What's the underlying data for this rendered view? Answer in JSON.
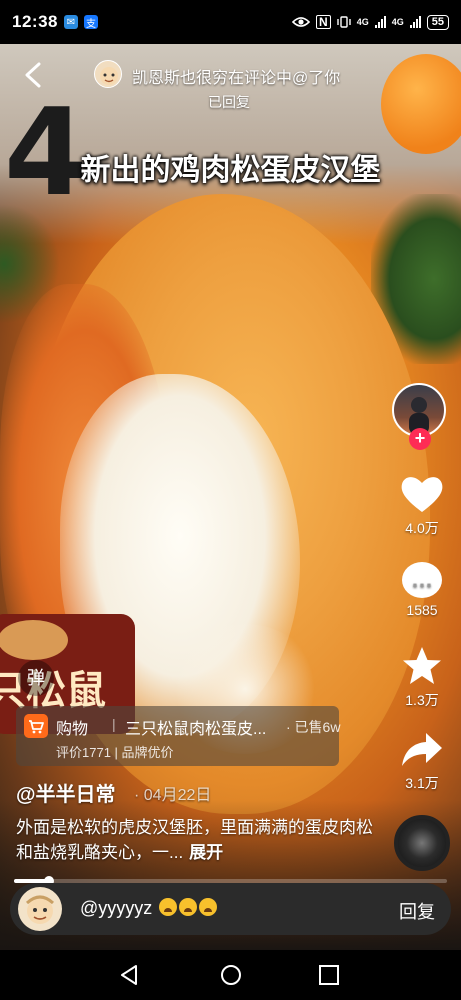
{
  "status_bar": {
    "time": "12:38",
    "battery": "55",
    "network_1": "4G",
    "network_2": "4G",
    "nfc": "N"
  },
  "overlay": {
    "notification_text": "凯恩斯也很穷在评论中@了你",
    "notification_sub": "已回复",
    "caption": "新出的鸡肉松蛋皮汉堡",
    "danmaku_label": "弹"
  },
  "background_text": {
    "big_number": "4",
    "package_text": "只松鼠"
  },
  "right_rail": {
    "likes": "4.0万",
    "comments": "1585",
    "favorites": "1.3万",
    "shares": "3.1万"
  },
  "product": {
    "category": "购物",
    "name": "三只松鼠肉松蛋皮...",
    "sold": "· 已售6w",
    "meta": "评价1771 | 品牌优价"
  },
  "post": {
    "author": "@半半日常",
    "date": "· 04月22日",
    "description": "外面是松软的虎皮汉堡胚，里面满满的蛋皮肉松和盐烧乳酪夹心，一...",
    "expand_label": "展开",
    "progress_fraction": 0.08
  },
  "comment_bar": {
    "text": "@yyyyyz",
    "reply_label": "回复",
    "emoji_count": 3
  },
  "colors": {
    "accent_red": "#fe2c55",
    "cart_orange": "#ff6a1a"
  },
  "icons": [
    "back-arrow-icon",
    "heart-icon",
    "comment-icon",
    "star-icon",
    "share-icon",
    "cart-icon",
    "nav-back-icon",
    "nav-home-icon",
    "nav-recents-icon"
  ]
}
